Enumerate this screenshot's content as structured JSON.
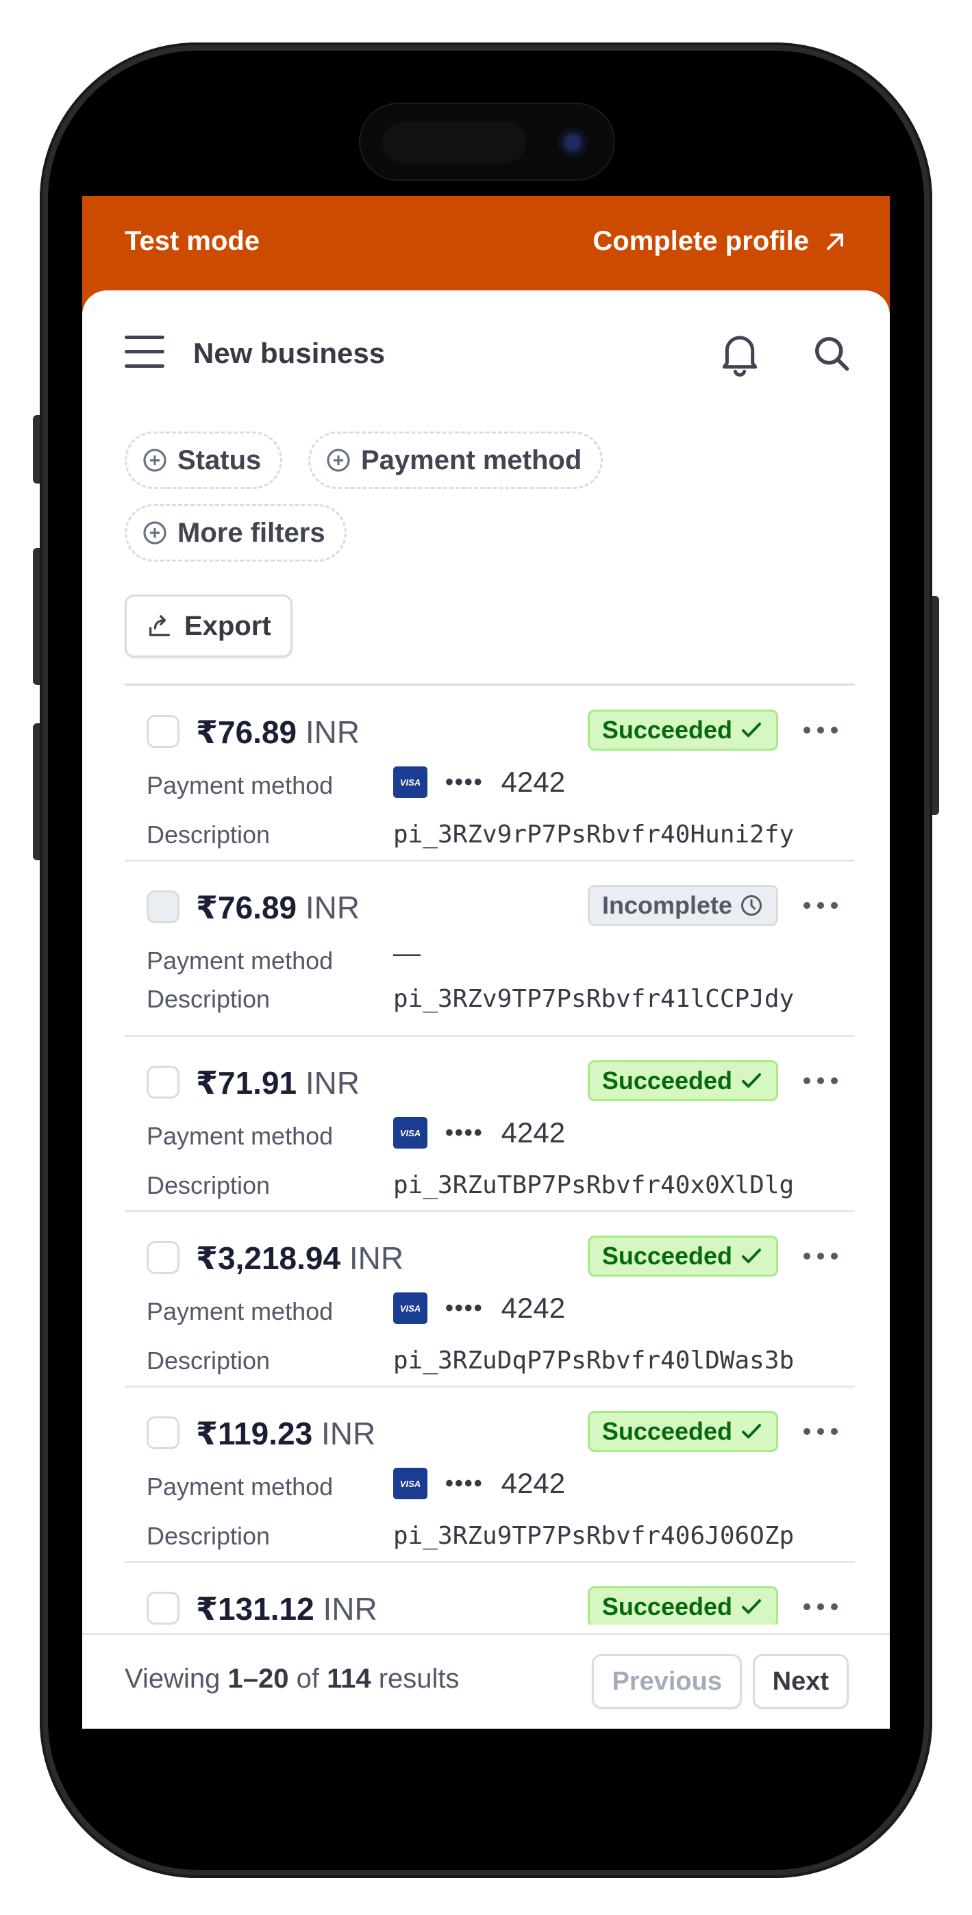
{
  "testbar": {
    "mode_label": "Test mode",
    "complete_label": "Complete profile"
  },
  "header": {
    "business": "New business"
  },
  "filters": {
    "status": "Status",
    "payment_method": "Payment method",
    "more": "More filters"
  },
  "export_label": "Export",
  "row_labels": {
    "payment_method": "Payment method",
    "description": "Description"
  },
  "rows": [
    {
      "amount": "₹76.89",
      "currency": "INR",
      "status": "Succeeded",
      "card_brand": "VISA",
      "dots": "••••",
      "last4": "4242",
      "description": "pi_3RZv9rP7PsRbvfr40Huni2fy"
    },
    {
      "amount": "₹76.89",
      "currency": "INR",
      "status": "Incomplete",
      "payment_method": "—",
      "description": "pi_3RZv9TP7PsRbvfr41lCCPJdy"
    },
    {
      "amount": "₹71.91",
      "currency": "INR",
      "status": "Succeeded",
      "card_brand": "VISA",
      "dots": "••••",
      "last4": "4242",
      "description": "pi_3RZuTBP7PsRbvfr40x0XlDlg"
    },
    {
      "amount": "₹3,218.94",
      "currency": "INR",
      "status": "Succeeded",
      "card_brand": "VISA",
      "dots": "••••",
      "last4": "4242",
      "description": "pi_3RZuDqP7PsRbvfr40lDWas3b"
    },
    {
      "amount": "₹119.23",
      "currency": "INR",
      "status": "Succeeded",
      "card_brand": "VISA",
      "dots": "••••",
      "last4": "4242",
      "description": "pi_3RZu9TP7PsRbvfr406J06OZp"
    },
    {
      "amount": "₹131.12",
      "currency": "INR",
      "status": "Succeeded"
    }
  ],
  "footer": {
    "viewing_prefix": "Viewing",
    "range": "1–20",
    "of": "of",
    "total": "114",
    "results": "results",
    "previous": "Previous",
    "next": "Next"
  },
  "colors": {
    "test_mode_bar": "#cc4b00",
    "success_bg": "#d7f7c2",
    "success_text": "#05690d",
    "neutral_badge_bg": "#ebeef1"
  }
}
